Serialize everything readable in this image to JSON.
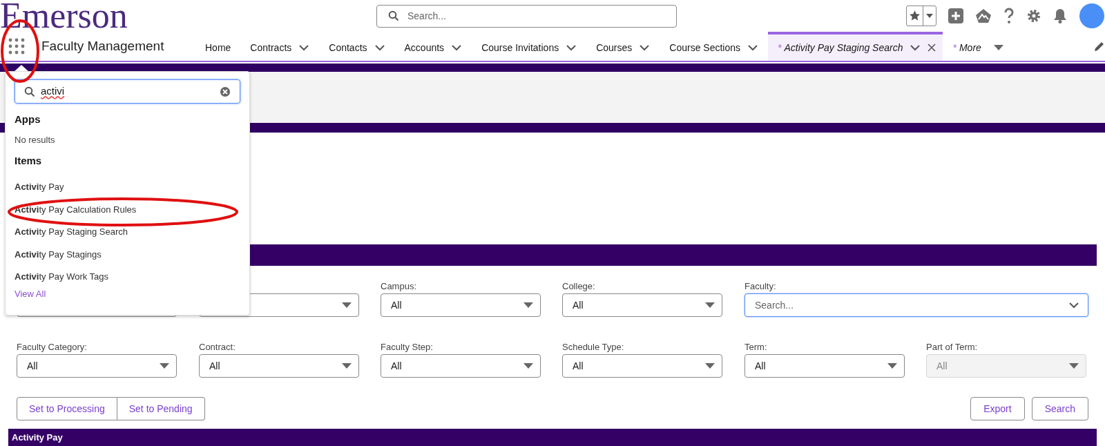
{
  "header": {
    "logo": "Emerson",
    "search": {
      "placeholder": "Search..."
    }
  },
  "app_name": "Faculty Management",
  "tabs": [
    {
      "label": "Home",
      "has_menu": false,
      "selected": false
    },
    {
      "label": "Contracts",
      "has_menu": true,
      "selected": false
    },
    {
      "label": "Contacts",
      "has_menu": true,
      "selected": false
    },
    {
      "label": "Accounts",
      "has_menu": true,
      "selected": false
    },
    {
      "label": "Course Invitations",
      "has_menu": true,
      "selected": false
    },
    {
      "label": "Courses",
      "has_menu": true,
      "selected": false
    },
    {
      "label": "Course Sections",
      "has_menu": true,
      "selected": false
    },
    {
      "label": "Activity Pay Staging Search",
      "marker": "*",
      "has_menu": true,
      "closable": true,
      "selected": true
    },
    {
      "label": "More",
      "marker": "*",
      "has_menu": true,
      "kind": "overflow",
      "selected": false
    }
  ],
  "app_launcher": {
    "query": "activi",
    "apps": {
      "heading": "Apps",
      "message": "No results"
    },
    "items": {
      "heading": "Items",
      "results": [
        "**Activi**ty Pay",
        "**Activi**ty Pay Calculation Rules",
        "**Activi**ty Pay Staging Search",
        "**Activi**ty Pay Stagings",
        "**Activi**ty Pay Work Tags"
      ]
    },
    "view_all": "View All"
  },
  "filters": [
    [
      {
        "kind": "covered"
      },
      {
        "kind": "covered"
      },
      {
        "kind": "select",
        "label": "Campus:",
        "value": "All",
        "disabled": false
      },
      {
        "kind": "select",
        "label": "College:",
        "value": "All",
        "disabled": false
      },
      {
        "kind": "combobox",
        "label": "Faculty:",
        "placeholder": "Search..."
      }
    ],
    [
      {
        "kind": "select",
        "label": "Faculty Category:",
        "value": "All",
        "disabled": false
      },
      {
        "kind": "select",
        "label": "Contract:",
        "value": "All",
        "disabled": false
      },
      {
        "kind": "select",
        "label": "Faculty Step:",
        "value": "All",
        "disabled": false
      },
      {
        "kind": "select",
        "label": "Schedule Type:",
        "value": "All",
        "disabled": false
      },
      {
        "kind": "select",
        "label": "Term:",
        "value": "All",
        "disabled": false
      },
      {
        "kind": "select",
        "label": "Part of Term:",
        "value": "All",
        "disabled": true
      }
    ]
  ],
  "status_buttons": [
    "Set to Processing",
    "Set to Pending"
  ],
  "action_buttons": [
    "Export",
    "Search"
  ],
  "results": {
    "title": "Activity Pay"
  }
}
